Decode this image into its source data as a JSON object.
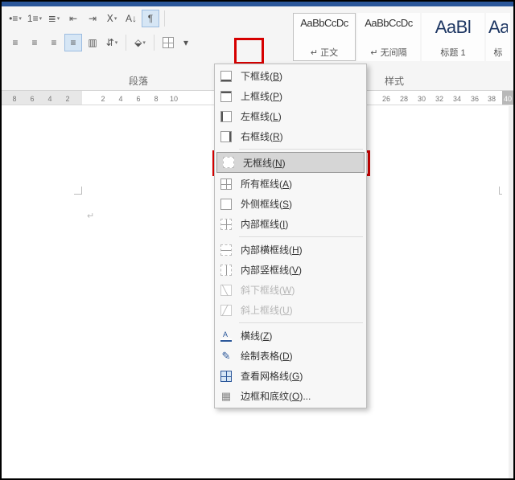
{
  "ribbon": {
    "group_paragraph": "段落",
    "group_styles": "样式"
  },
  "styles": [
    {
      "preview": "AaBbCcDc",
      "name": "↵ 正文",
      "big": false
    },
    {
      "preview": "AaBbCcDc",
      "name": "↵ 无间隔",
      "big": false
    },
    {
      "preview": "AaBl",
      "name": "标题 1",
      "big": true
    },
    {
      "preview": "Aa",
      "name": "标",
      "big": true
    }
  ],
  "ruler_numbers_left": [
    "8",
    "6",
    "4",
    "2"
  ],
  "ruler_numbers_right": [
    "2",
    "4",
    "6",
    "8",
    "10",
    "26",
    "28",
    "30",
    "32",
    "34",
    "36",
    "38",
    "40"
  ],
  "menu": {
    "items": [
      {
        "label": "下框线",
        "key": "B",
        "icon": "bottom",
        "disabled": false
      },
      {
        "label": "上框线",
        "key": "P",
        "icon": "top",
        "disabled": false
      },
      {
        "label": "左框线",
        "key": "L",
        "icon": "left",
        "disabled": false
      },
      {
        "label": "右框线",
        "key": "R",
        "icon": "right",
        "disabled": false
      }
    ],
    "items2": [
      {
        "label": "无框线",
        "key": "N",
        "icon": "none",
        "highlight": true
      },
      {
        "label": "所有框线",
        "key": "A",
        "icon": "all",
        "disabled": false
      },
      {
        "label": "外侧框线",
        "key": "S",
        "icon": "outside",
        "disabled": false
      },
      {
        "label": "内部框线",
        "key": "I",
        "icon": "inside",
        "disabled": false
      }
    ],
    "items3": [
      {
        "label": "内部横框线",
        "key": "H",
        "icon": "inh",
        "disabled": false
      },
      {
        "label": "内部竖框线",
        "key": "V",
        "icon": "inv",
        "disabled": false
      },
      {
        "label": "斜下框线",
        "key": "W",
        "icon": "diagd",
        "disabled": true
      },
      {
        "label": "斜上框线",
        "key": "U",
        "icon": "diagu",
        "disabled": true
      }
    ],
    "items4": [
      {
        "label": "横线",
        "key": "Z",
        "icon": "hline",
        "special": "hlineA"
      },
      {
        "label": "绘制表格",
        "key": "D",
        "icon": "pencil"
      },
      {
        "label": "查看网格线",
        "key": "G",
        "icon": "grid"
      },
      {
        "label": "边框和底纹",
        "key": "O",
        "icon": "shade",
        "ellipsis": true
      }
    ]
  }
}
